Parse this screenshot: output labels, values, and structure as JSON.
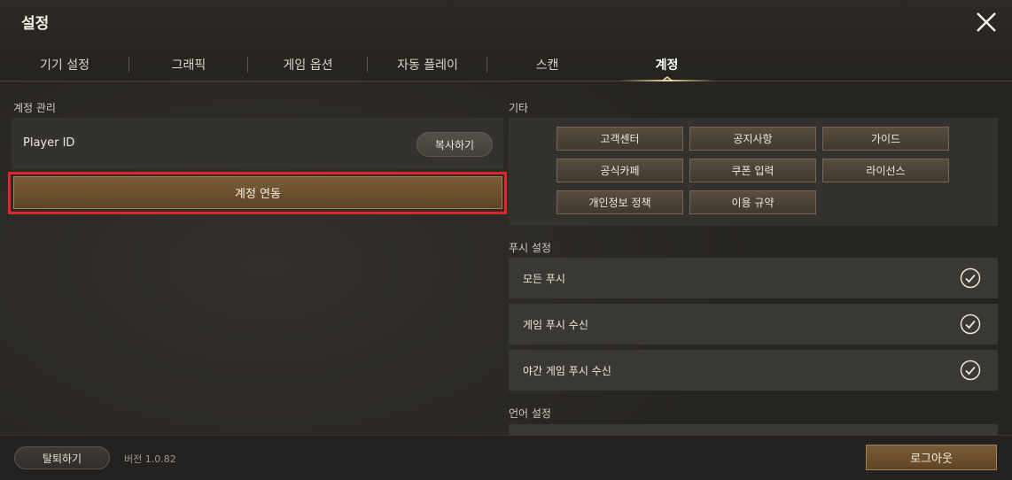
{
  "title": "설정",
  "tabs": [
    {
      "label": "기기 설정",
      "active": false
    },
    {
      "label": "그래픽",
      "active": false
    },
    {
      "label": "게임 옵션",
      "active": false
    },
    {
      "label": "자동 플레이",
      "active": false
    },
    {
      "label": "스캔",
      "active": false
    },
    {
      "label": "계정",
      "active": true
    }
  ],
  "account": {
    "section_label": "계정 관리",
    "player_id_label": "Player ID",
    "copy_label": "복사하기",
    "link_label": "계정 연동"
  },
  "etc": {
    "section_label": "기타",
    "buttons": [
      "고객센터",
      "공지사항",
      "가이드",
      "공식카페",
      "쿠폰 입력",
      "라이선스",
      "개인정보 정책",
      "이용 규약"
    ]
  },
  "push": {
    "section_label": "푸시 설정",
    "items": [
      {
        "label": "모든 푸시",
        "checked": true
      },
      {
        "label": "게임 푸시 수신",
        "checked": true
      },
      {
        "label": "야간 게임 푸시 수신",
        "checked": true
      }
    ]
  },
  "language": {
    "section_label": "언어 설정"
  },
  "footer": {
    "quit_label": "탈퇴하기",
    "version": "버전 1.0.82",
    "logout_label": "로그아웃"
  },
  "colors": {
    "accent": "#7a5c36",
    "highlight": "#e0262a"
  },
  "icons": {
    "close": "close-icon",
    "check": "check-circle-icon"
  }
}
